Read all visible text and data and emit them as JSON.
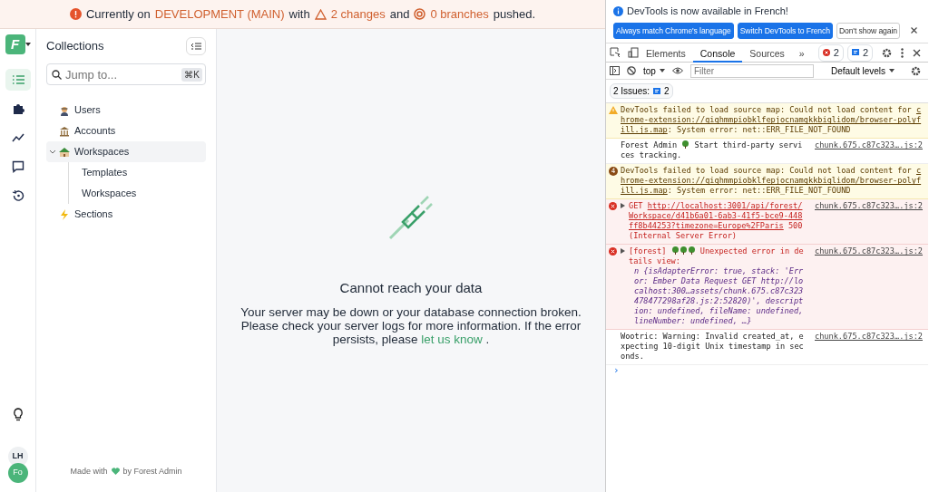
{
  "banner": {
    "parts": [
      {
        "kind": "text",
        "text": "Currently on"
      },
      {
        "kind": "highlight",
        "text": "DEVELOPMENT (MAIN)"
      },
      {
        "kind": "text",
        "text": "with"
      },
      {
        "kind": "changes",
        "text": "2 changes"
      },
      {
        "kind": "text",
        "text": "and"
      },
      {
        "kind": "branches",
        "text": "0 branches"
      },
      {
        "kind": "text",
        "text": "pushed."
      }
    ]
  },
  "rail": {
    "logo": "F",
    "items": [
      {
        "kind": "list",
        "selected": true
      },
      {
        "kind": "puzzle",
        "selected": false
      },
      {
        "kind": "chart",
        "selected": false
      },
      {
        "kind": "chat",
        "selected": false
      },
      {
        "kind": "history",
        "selected": false
      }
    ],
    "avatars": [
      "LH",
      "Fo"
    ]
  },
  "collections": {
    "title": "Collections",
    "search": {
      "placeholder": "Jump to...",
      "shortcut": "⌘K"
    },
    "items": [
      {
        "label": "Users",
        "kind": "person",
        "selected": false
      },
      {
        "label": "Accounts",
        "kind": "bank",
        "selected": false
      },
      {
        "label": "Workspaces",
        "kind": "house",
        "selected": true,
        "expanded": true,
        "children": [
          {
            "label": "Templates",
            "selected": false
          },
          {
            "label": "Workspaces",
            "selected": false
          }
        ]
      },
      {
        "label": "Sections",
        "kind": "bolt",
        "selected": false
      }
    ],
    "footer": {
      "before": "Made with",
      "after": "by Forest Admin"
    }
  },
  "main": {
    "title": "Cannot reach your data",
    "message": "Your server may be down or your database connection broken. Please check your server logs for more information. If the error persists, please",
    "link": "let us know",
    "end": "."
  },
  "devtools": {
    "info": "DevTools is now available in French!",
    "buttons": [
      {
        "label": "Always match Chrome's language",
        "kind": "primary"
      },
      {
        "label": "Switch DevTools to French",
        "kind": "primary"
      },
      {
        "label": "Don't show again",
        "kind": "plain"
      }
    ],
    "tabs": [
      {
        "label": "Elements",
        "selected": false
      },
      {
        "label": "Console",
        "selected": true
      },
      {
        "label": "Sources",
        "selected": false
      }
    ],
    "more": "»",
    "errors": "2",
    "issues": "2",
    "context": "top",
    "filter_placeholder": "Filter",
    "levels": "Default levels",
    "issues_bar": {
      "label": "2 Issues:",
      "count": "2"
    },
    "messages": [
      {
        "kind": "warning",
        "parts": [
          {
            "kind": "text",
            "text": "DevTools failed to load source map: Could not load content for "
          },
          {
            "kind": "link",
            "text": "chrome-extension://gighmmpiobklfepjocnamgkkbiglidom/browser-polyfill.js.map"
          },
          {
            "kind": "text",
            "text": ": System error: net::ERR_FILE_NOT_FOUND"
          }
        ]
      },
      {
        "kind": "info",
        "source": "chunk.675.c87c323….js:2",
        "parts": [
          {
            "kind": "text",
            "text": "Forest Admin "
          },
          {
            "kind": "icon"
          },
          {
            "kind": "text",
            "text": " Start third-party services tracking."
          }
        ]
      },
      {
        "kind": "warning",
        "count": "4",
        "parts": [
          {
            "kind": "text",
            "text": "DevTools failed to load source map: Could not load content for "
          },
          {
            "kind": "link",
            "text": "chrome-extension://gighmmpiobklfepjocnamgkkbiglidom/browser-polyfill.js.map"
          },
          {
            "kind": "text",
            "text": ": System error: net::ERR_FILE_NOT_FOUND"
          }
        ]
      },
      {
        "kind": "error",
        "source": "chunk.675.c87c323….js:2",
        "expandable": true,
        "parts": [
          {
            "kind": "text",
            "text": "GET "
          },
          {
            "kind": "link",
            "text": "http://localhost:3001/api/forest/Workspace/d41b6a01-6ab3-41f5-bce9-448ff8b44253?timezone=Europe%2FParis"
          },
          {
            "kind": "text",
            "text": " 500 (Internal Server Error)"
          }
        ]
      },
      {
        "kind": "error",
        "source": "chunk.675.c87c323….js:2",
        "expandable": true,
        "parts": [
          {
            "kind": "text",
            "text": "[forest] "
          },
          {
            "kind": "icon"
          },
          {
            "kind": "icon"
          },
          {
            "kind": "icon"
          },
          {
            "kind": "text",
            "text": " Unexpected error in details view:"
          }
        ],
        "detail": "n {isAdapterError: true, stack: 'Error: Ember Data Request GET http://localhost:300…assets/chunk.675.c87c323478477298af28.js:2:52820)', description: undefined, fileName: undefined, lineNumber: undefined, …}"
      },
      {
        "kind": "info",
        "source": "chunk.675.c87c323….js:2",
        "parts": [
          {
            "kind": "text",
            "text": "Wootric: Warning: Invalid created_at, expecting 10-digit Unix timestamp in seconds."
          }
        ]
      }
    ],
    "prompt": "›"
  }
}
